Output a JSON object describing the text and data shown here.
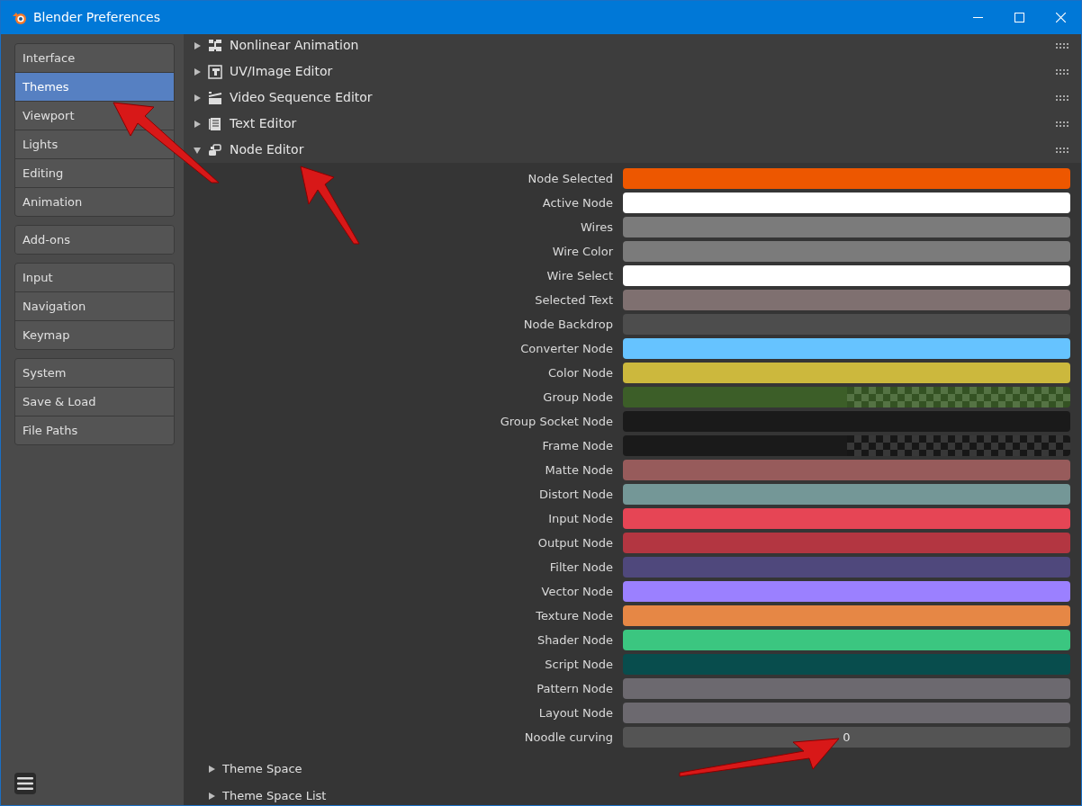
{
  "window": {
    "title": "Blender Preferences"
  },
  "sidebar": {
    "groups": [
      [
        {
          "label": "Interface",
          "selected": false
        },
        {
          "label": "Themes",
          "selected": true
        },
        {
          "label": "Viewport",
          "selected": false
        },
        {
          "label": "Lights",
          "selected": false
        },
        {
          "label": "Editing",
          "selected": false
        },
        {
          "label": "Animation",
          "selected": false
        }
      ],
      [
        {
          "label": "Add-ons",
          "selected": false
        }
      ],
      [
        {
          "label": "Input",
          "selected": false
        },
        {
          "label": "Navigation",
          "selected": false
        },
        {
          "label": "Keymap",
          "selected": false
        }
      ],
      [
        {
          "label": "System",
          "selected": false
        },
        {
          "label": "Save & Load",
          "selected": false
        },
        {
          "label": "File Paths",
          "selected": false
        }
      ]
    ]
  },
  "editors": [
    {
      "label": "Nonlinear Animation",
      "expanded": false
    },
    {
      "label": "UV/Image Editor",
      "expanded": false
    },
    {
      "label": "Video Sequence Editor",
      "expanded": false
    },
    {
      "label": "Text Editor",
      "expanded": false
    },
    {
      "label": "Node Editor",
      "expanded": true
    }
  ],
  "node_editor": {
    "properties": [
      {
        "kind": "color",
        "label": "Node Selected",
        "color": "#ed5700",
        "alpha": false
      },
      {
        "kind": "color",
        "label": "Active Node",
        "color": "#ffffff",
        "alpha": false
      },
      {
        "kind": "color",
        "label": "Wires",
        "color": "#7b7b7b",
        "alpha": false
      },
      {
        "kind": "color",
        "label": "Wire Color",
        "color": "#7b7b7b",
        "alpha": false
      },
      {
        "kind": "color",
        "label": "Wire Select",
        "color": "#ffffff",
        "alpha": false
      },
      {
        "kind": "color",
        "label": "Selected Text",
        "color": "#7f7070",
        "alpha": false
      },
      {
        "kind": "color",
        "label": "Node Backdrop",
        "color": "#4d4d4d",
        "alpha": false
      },
      {
        "kind": "color",
        "label": "Converter Node",
        "color": "#66c3ff",
        "alpha": false
      },
      {
        "kind": "color",
        "label": "Color Node",
        "color": "#ccb83d",
        "alpha": false
      },
      {
        "kind": "color",
        "label": "Group Node",
        "color": "#3c5e28",
        "alpha": true
      },
      {
        "kind": "color",
        "label": "Group Socket Node",
        "color": "#1a1a1a",
        "alpha": false
      },
      {
        "kind": "color",
        "label": "Frame Node",
        "color": "#1a1a1a",
        "alpha": true
      },
      {
        "kind": "color",
        "label": "Matte Node",
        "color": "#975b5b",
        "alpha": false
      },
      {
        "kind": "color",
        "label": "Distort Node",
        "color": "#749797",
        "alpha": false
      },
      {
        "kind": "color",
        "label": "Input Node",
        "color": "#e64555",
        "alpha": false
      },
      {
        "kind": "color",
        "label": "Output Node",
        "color": "#b33641",
        "alpha": false
      },
      {
        "kind": "color",
        "label": "Filter Node",
        "color": "#4f487c",
        "alpha": false
      },
      {
        "kind": "color",
        "label": "Vector Node",
        "color": "#9b80ff",
        "alpha": false
      },
      {
        "kind": "color",
        "label": "Texture Node",
        "color": "#e68745",
        "alpha": false
      },
      {
        "kind": "color",
        "label": "Shader Node",
        "color": "#3bc680",
        "alpha": false
      },
      {
        "kind": "color",
        "label": "Script Node",
        "color": "#084d4d",
        "alpha": false
      },
      {
        "kind": "color",
        "label": "Pattern Node",
        "color": "#6c696f",
        "alpha": false
      },
      {
        "kind": "color",
        "label": "Layout Node",
        "color": "#6c696f",
        "alpha": false
      },
      {
        "kind": "number",
        "label": "Noodle curving",
        "value": "0"
      }
    ]
  },
  "sections": [
    {
      "label": "Theme Space",
      "expanded": false
    },
    {
      "label": "Theme Space List",
      "expanded": false
    }
  ]
}
